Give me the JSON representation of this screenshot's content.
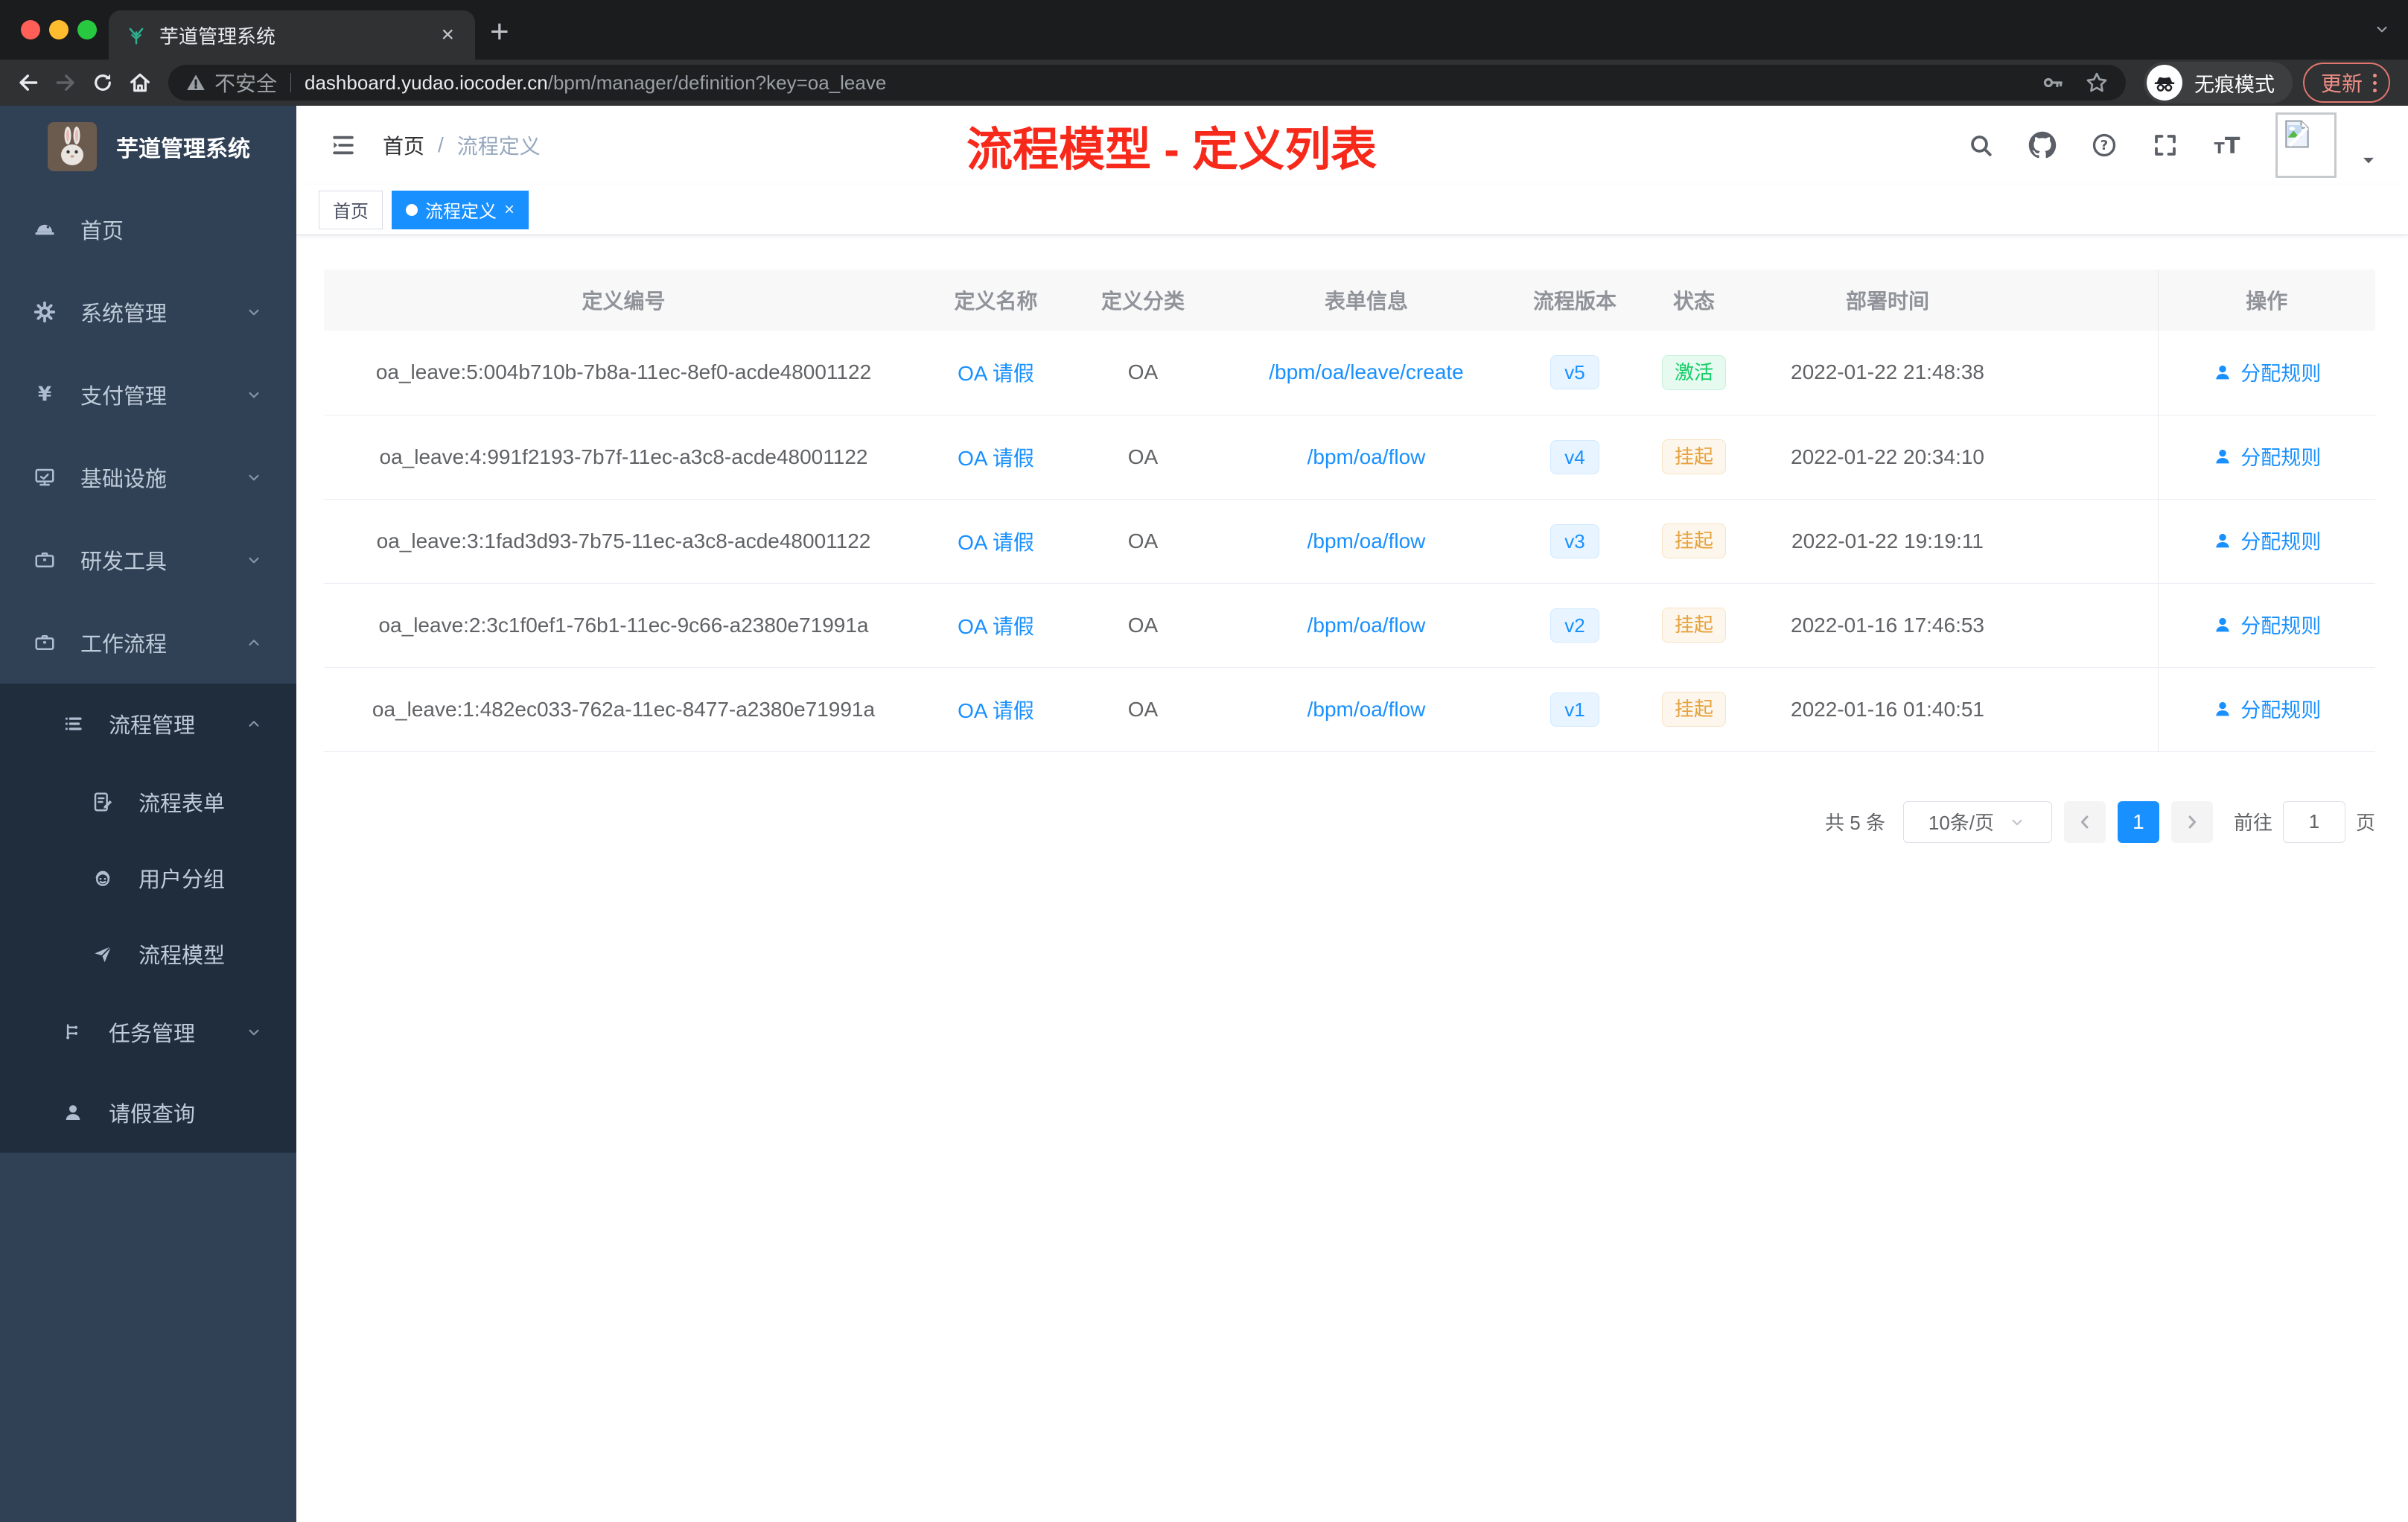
{
  "browser": {
    "tab_title": "芋道管理系统",
    "new_tab": "+",
    "close_tab": "×",
    "security_label": "不安全",
    "url_host": "dashboard.yudao.iocoder.cn",
    "url_path": "/bpm/manager/definition?key=oa_leave",
    "incognito_label": "无痕模式",
    "update_label": "更新",
    "traffic_colors": {
      "close": "#ff5f57",
      "minimize": "#febc2e",
      "zoom": "#28c840"
    }
  },
  "sidebar": {
    "app_title": "芋道管理系统",
    "items": [
      {
        "label": "首页",
        "icon": "dashboard",
        "level": 1,
        "chevron": null,
        "dark": false
      },
      {
        "label": "系统管理",
        "icon": "gear",
        "level": 1,
        "chevron": "down",
        "dark": false
      },
      {
        "label": "支付管理",
        "icon": "yen",
        "level": 1,
        "chevron": "down",
        "dark": false
      },
      {
        "label": "基础设施",
        "icon": "monitor",
        "level": 1,
        "chevron": "down",
        "dark": false
      },
      {
        "label": "研发工具",
        "icon": "toolbox",
        "level": 1,
        "chevron": "down",
        "dark": false
      },
      {
        "label": "工作流程",
        "icon": "toolbox",
        "level": 1,
        "chevron": "up",
        "dark": false
      },
      {
        "label": "流程管理",
        "icon": "list",
        "level": 2,
        "chevron": "up",
        "dark": true
      },
      {
        "label": "流程表单",
        "icon": "form",
        "level": 3,
        "chevron": null,
        "dark": true
      },
      {
        "label": "用户分组",
        "icon": "group",
        "level": 3,
        "chevron": null,
        "dark": true
      },
      {
        "label": "流程模型",
        "icon": "paper-plane",
        "level": 3,
        "chevron": null,
        "dark": true
      },
      {
        "label": "任务管理",
        "icon": "task",
        "level": 2,
        "chevron": "down",
        "dark": true
      },
      {
        "label": "请假查询",
        "icon": "user",
        "level": 2,
        "chevron": null,
        "dark": true
      }
    ]
  },
  "header": {
    "breadcrumb_home": "首页",
    "breadcrumb_sep": "/",
    "breadcrumb_current": "流程定义",
    "annotation": "流程模型 - 定义列表",
    "annotation_color": "#f7291b"
  },
  "tags": [
    {
      "label": "首页",
      "active": false,
      "closable": false
    },
    {
      "label": "流程定义",
      "active": true,
      "closable": true
    }
  ],
  "table": {
    "columns": [
      "定义编号",
      "定义名称",
      "定义分类",
      "表单信息",
      "流程版本",
      "状态",
      "部署时间",
      "操作"
    ],
    "rows": [
      {
        "id": "oa_leave:5:004b710b-7b8a-11ec-8ef0-acde48001122",
        "name": "OA 请假",
        "category": "OA",
        "form": "/bpm/oa/leave/create",
        "version": "v5",
        "status": "激活",
        "status_type": "active",
        "time": "2022-01-22 21:48:38",
        "action": "分配规则"
      },
      {
        "id": "oa_leave:4:991f2193-7b7f-11ec-a3c8-acde48001122",
        "name": "OA 请假",
        "category": "OA",
        "form": "/bpm/oa/flow",
        "version": "v4",
        "status": "挂起",
        "status_type": "suspended",
        "time": "2022-01-22 20:34:10",
        "action": "分配规则"
      },
      {
        "id": "oa_leave:3:1fad3d93-7b75-11ec-a3c8-acde48001122",
        "name": "OA 请假",
        "category": "OA",
        "form": "/bpm/oa/flow",
        "version": "v3",
        "status": "挂起",
        "status_type": "suspended",
        "time": "2022-01-22 19:19:11",
        "action": "分配规则"
      },
      {
        "id": "oa_leave:2:3c1f0ef1-76b1-11ec-9c66-a2380e71991a",
        "name": "OA 请假",
        "category": "OA",
        "form": "/bpm/oa/flow",
        "version": "v2",
        "status": "挂起",
        "status_type": "suspended",
        "time": "2022-01-16 17:46:53",
        "action": "分配规则"
      },
      {
        "id": "oa_leave:1:482ec033-762a-11ec-8477-a2380e71991a",
        "name": "OA 请假",
        "category": "OA",
        "form": "/bpm/oa/flow",
        "version": "v1",
        "status": "挂起",
        "status_type": "suspended",
        "time": "2022-01-16 01:40:51",
        "action": "分配规则"
      }
    ]
  },
  "pagination": {
    "total_label": "共 5 条",
    "page_size_label": "10条/页",
    "current_page": "1",
    "goto_label": "前往",
    "goto_value": "1",
    "goto_unit": "页"
  },
  "colors": {
    "accent_blue": "#1890ff",
    "sidebar_bg": "#304156",
    "sidebar_sub_bg": "#1f2d3d",
    "status_active": "#13ce66",
    "status_suspended": "#e6a23c"
  }
}
